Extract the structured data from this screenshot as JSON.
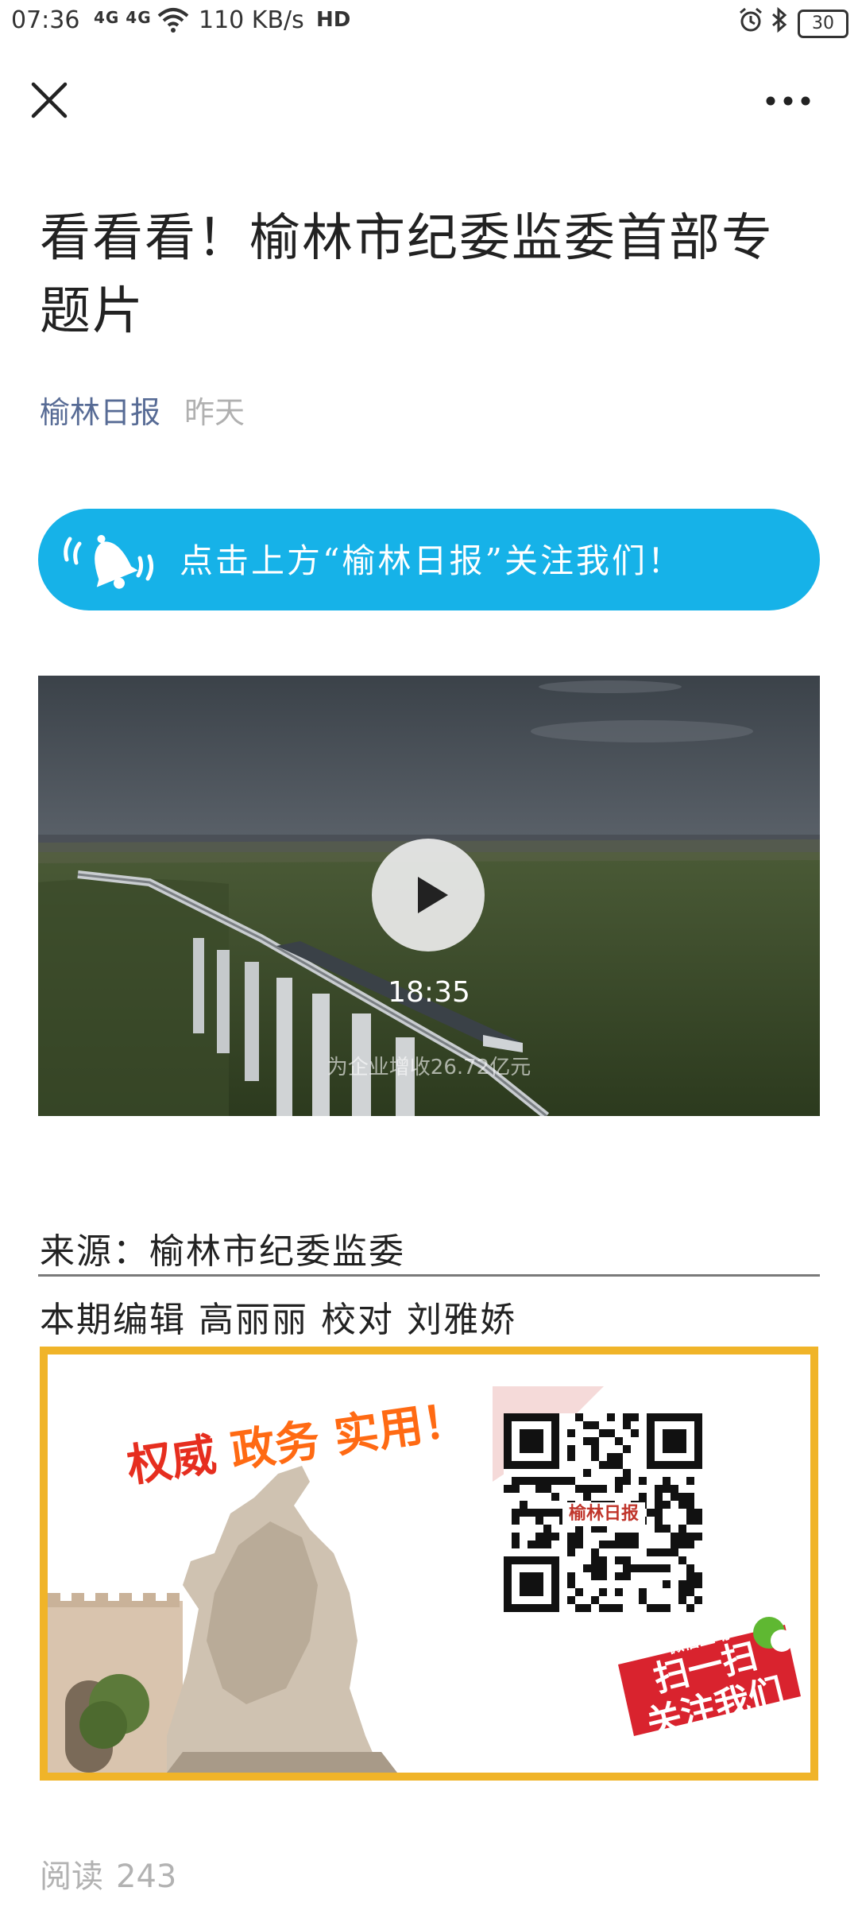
{
  "status_bar": {
    "time": "07:36",
    "network": "4G 4G",
    "speed": "110 KB/s",
    "hd": "HD",
    "battery": "30"
  },
  "nav": {
    "close_icon": "close-icon",
    "more_icon": "more-icon"
  },
  "article": {
    "title": "看看看！榆林市纪委监委首部专题片",
    "source_name": "榆林日报",
    "date": "昨天"
  },
  "banner": {
    "text": "点击上方“榆林日报”关注我们！",
    "color": "#16b2e8"
  },
  "video": {
    "duration": "18:35",
    "subtitle": "为企业增收26.72亿元"
  },
  "body": {
    "source_line": "来源：榆林市纪委监委",
    "editor_line": "本期编辑 高丽丽 校对 刘雅娇"
  },
  "promo": {
    "slogan_1": "权威",
    "slogan_2": "政务",
    "slogan_3": "实用！",
    "qr_label": "榆林日报",
    "cta_small": "微信互动",
    "cta_line1": "扫一扫",
    "cta_line2": "关注我们",
    "border_color": "#f0b429"
  },
  "footer": {
    "reads_label": "阅读",
    "reads_count": "243"
  }
}
